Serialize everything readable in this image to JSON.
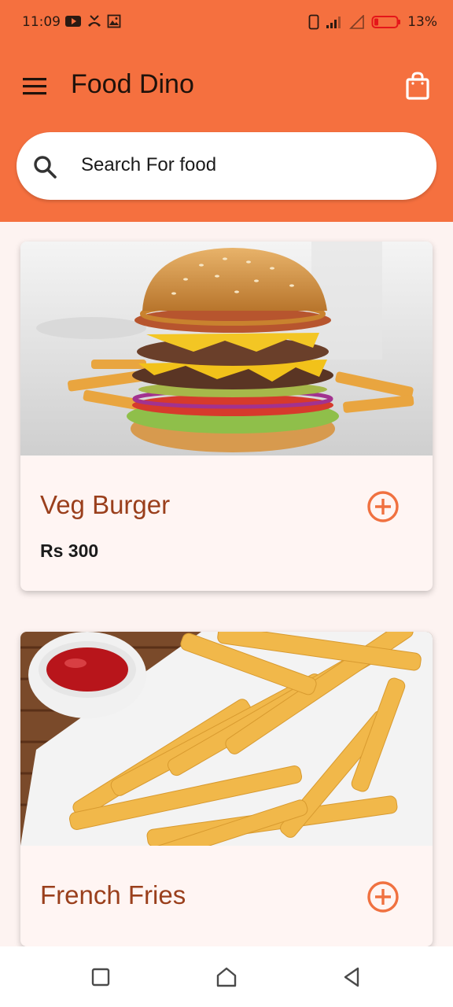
{
  "status_bar": {
    "time": "11:09",
    "battery_percent": "13%"
  },
  "toolbar": {
    "title": "Food Dino"
  },
  "search": {
    "placeholder": "Search For food"
  },
  "colors": {
    "primary": "#f5703f",
    "card_title": "#9a3f1c",
    "background": "#fdf3f1"
  },
  "products": [
    {
      "name": "Veg Burger",
      "price": "Rs 300",
      "image": "burger-photo"
    },
    {
      "name": "French Fries",
      "image": "fries-photo"
    }
  ],
  "nav": {
    "buttons": [
      "recents-icon",
      "home-icon",
      "back-icon"
    ]
  }
}
